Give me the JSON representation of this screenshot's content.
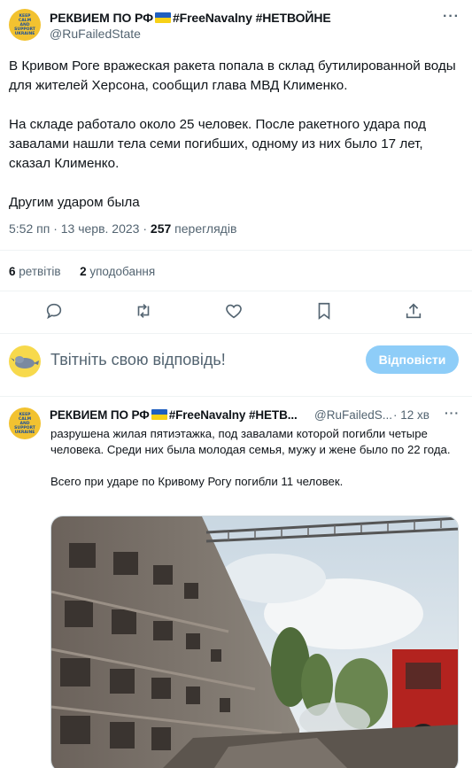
{
  "main_tweet": {
    "avatar_text": [
      "KEEP",
      "CALM",
      "AND",
      "SUPPORT",
      "UKRAINE"
    ],
    "name_part1": "РЕКВИЕМ ПО РФ",
    "name_part2": "#FreeNavalny #НЕТВОЙНЕ",
    "handle": "@RuFailedState",
    "more": "···",
    "paragraphs": [
      "В Кривом Роге вражеская ракета попала в склад бутилированной воды для жителей Херсона, сообщил глава МВД Клименко.",
      "На складе работало около 25 человек. После ракетного удара под завалами нашли тела семи погибших, одному из них было 17 лет, сказал Клименко.",
      "Другим ударом была"
    ],
    "time": "5:52 пп",
    "separator": " · ",
    "date": "13 черв. 2023",
    "views_count": "257",
    "views_label": "переглядів",
    "retweets_count": "6",
    "retweets_label": "ретвітів",
    "likes_count": "2",
    "likes_label": "уподобання"
  },
  "actions": {
    "icons": [
      "reply-icon",
      "retweet-icon",
      "like-icon",
      "bookmark-icon",
      "share-icon"
    ]
  },
  "reply_box": {
    "placeholder": "Твітніть свою відповідь!",
    "button": "Відповісти",
    "avatar_color": "#f7d94c"
  },
  "reply_tweet": {
    "name_part1": "РЕКВИЕМ ПО РФ",
    "name_part2": "#FreeNavalny #НЕТВ...",
    "handle": "@RuFailedS...",
    "time": "· 12 хв",
    "more": "···",
    "paragraphs": [
      "разрушена жилая пятиэтажка, под завалами которой погибли четыре человека. Среди них была молодая семья, мужу и жене было по 22 года.",
      "Всего при ударе по Кривому Рогу погибли 11 человек."
    ]
  },
  "colors": {
    "accent": "#1d9bf0",
    "reply_button": "#8ecdf8",
    "muted_text": "#536471",
    "flag_blue": "#1f5fbf",
    "flag_yellow": "#f7d117"
  }
}
